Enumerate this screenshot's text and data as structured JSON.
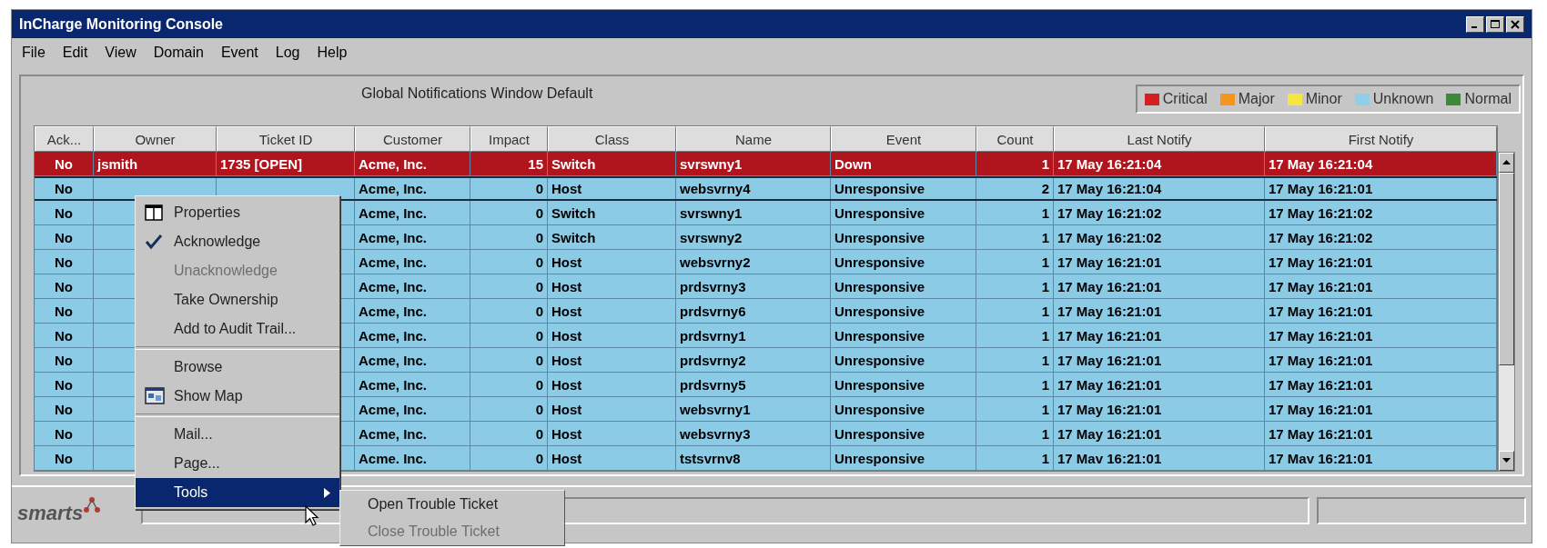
{
  "window": {
    "title": "InCharge Monitoring Console"
  },
  "menu_bar": [
    "File",
    "Edit",
    "View",
    "Domain",
    "Event",
    "Log",
    "Help"
  ],
  "panel_title": "Global Notifications Window Default",
  "legend": [
    {
      "label": "Critical",
      "color": "#d42020"
    },
    {
      "label": "Major",
      "color": "#f7941d"
    },
    {
      "label": "Minor",
      "color": "#f5e642"
    },
    {
      "label": "Unknown",
      "color": "#8fd0e8"
    },
    {
      "label": "Normal",
      "color": "#3a8a3a"
    }
  ],
  "table": {
    "columns": [
      "Ack...",
      "Owner",
      "Ticket ID",
      "Customer",
      "Impact",
      "Class",
      "Name",
      "Event",
      "Count",
      "Last Notify",
      "First Notify"
    ],
    "rows": [
      {
        "color": "#b0141c",
        "selected": false,
        "cells": [
          "No",
          "jsmith",
          "1735 [OPEN]",
          "Acme, Inc.",
          "15",
          "Switch",
          "svrswny1",
          "Down",
          "1",
          "17 May 16:21:04",
          "17 May 16:21:04"
        ]
      },
      {
        "color": "#8ccbe6",
        "selected": true,
        "cells": [
          "No",
          "",
          "",
          "Acme, Inc.",
          "0",
          "Host",
          "websvrny4",
          "Unresponsive",
          "2",
          "17 May 16:21:04",
          "17 May 16:21:01"
        ]
      },
      {
        "color": "#8ccbe6",
        "selected": false,
        "cells": [
          "No",
          "",
          "",
          "Acme, Inc.",
          "0",
          "Switch",
          "svrswny1",
          "Unresponsive",
          "1",
          "17 May 16:21:02",
          "17 May 16:21:02"
        ]
      },
      {
        "color": "#8ccbe6",
        "selected": false,
        "cells": [
          "No",
          "",
          "",
          "Acme, Inc.",
          "0",
          "Switch",
          "svrswny2",
          "Unresponsive",
          "1",
          "17 May 16:21:02",
          "17 May 16:21:02"
        ]
      },
      {
        "color": "#8ccbe6",
        "selected": false,
        "cells": [
          "No",
          "",
          "",
          "Acme, Inc.",
          "0",
          "Host",
          "websvrny2",
          "Unresponsive",
          "1",
          "17 May 16:21:01",
          "17 May 16:21:01"
        ]
      },
      {
        "color": "#8ccbe6",
        "selected": false,
        "cells": [
          "No",
          "",
          "",
          "Acme, Inc.",
          "0",
          "Host",
          "prdsvrny3",
          "Unresponsive",
          "1",
          "17 May 16:21:01",
          "17 May 16:21:01"
        ]
      },
      {
        "color": "#8ccbe6",
        "selected": false,
        "cells": [
          "No",
          "",
          "",
          "Acme, Inc.",
          "0",
          "Host",
          "prdsvrny6",
          "Unresponsive",
          "1",
          "17 May 16:21:01",
          "17 May 16:21:01"
        ]
      },
      {
        "color": "#8ccbe6",
        "selected": false,
        "cells": [
          "No",
          "",
          "",
          "Acme, Inc.",
          "0",
          "Host",
          "prdsvrny1",
          "Unresponsive",
          "1",
          "17 May 16:21:01",
          "17 May 16:21:01"
        ]
      },
      {
        "color": "#8ccbe6",
        "selected": false,
        "cells": [
          "No",
          "",
          "",
          "Acme, Inc.",
          "0",
          "Host",
          "prdsvrny2",
          "Unresponsive",
          "1",
          "17 May 16:21:01",
          "17 May 16:21:01"
        ]
      },
      {
        "color": "#8ccbe6",
        "selected": false,
        "cells": [
          "No",
          "",
          "",
          "Acme, Inc.",
          "0",
          "Host",
          "prdsvrny5",
          "Unresponsive",
          "1",
          "17 May 16:21:01",
          "17 May 16:21:01"
        ]
      },
      {
        "color": "#8ccbe6",
        "selected": false,
        "cells": [
          "No",
          "",
          "",
          "Acme, Inc.",
          "0",
          "Host",
          "websvrny1",
          "Unresponsive",
          "1",
          "17 May 16:21:01",
          "17 May 16:21:01"
        ]
      },
      {
        "color": "#8ccbe6",
        "selected": false,
        "cells": [
          "No",
          "",
          "",
          "Acme, Inc.",
          "0",
          "Host",
          "websvrny3",
          "Unresponsive",
          "1",
          "17 May 16:21:01",
          "17 May 16:21:01"
        ]
      },
      {
        "color": "#8ccbe6",
        "selected": false,
        "cells": [
          "No",
          "",
          "",
          "Acme. Inc.",
          "0",
          "Host",
          "tstsvrnv8",
          "Unresponsive",
          "1",
          "17 Mav 16:21:01",
          "17 Mav 16:21:01"
        ]
      }
    ]
  },
  "context_menu": {
    "groups": [
      [
        {
          "label": "Properties",
          "kind": "panel",
          "disabled": false,
          "selected": false
        },
        {
          "label": "Acknowledge",
          "kind": "check",
          "disabled": false,
          "selected": false
        },
        {
          "label": "Unacknowledge",
          "kind": "plain",
          "disabled": true,
          "selected": false
        },
        {
          "label": "Take Ownership",
          "kind": "plain",
          "disabled": false,
          "selected": false
        },
        {
          "label": "Add to Audit Trail...",
          "kind": "plain",
          "disabled": false,
          "selected": false
        }
      ],
      [
        {
          "label": "Browse",
          "kind": "plain",
          "disabled": false,
          "selected": false
        },
        {
          "label": "Show Map",
          "kind": "map",
          "disabled": false,
          "selected": false
        }
      ],
      [
        {
          "label": "Mail...",
          "kind": "plain",
          "disabled": false,
          "selected": false
        },
        {
          "label": "Page...",
          "kind": "plain",
          "disabled": false,
          "selected": false
        },
        {
          "label": "Tools",
          "kind": "submenu",
          "disabled": false,
          "selected": true
        }
      ]
    ]
  },
  "submenu": [
    {
      "label": "Open Trouble Ticket",
      "disabled": false
    },
    {
      "label": "Close Trouble Ticket",
      "disabled": true
    }
  ],
  "status_bar": {
    "logo": "smarts"
  }
}
